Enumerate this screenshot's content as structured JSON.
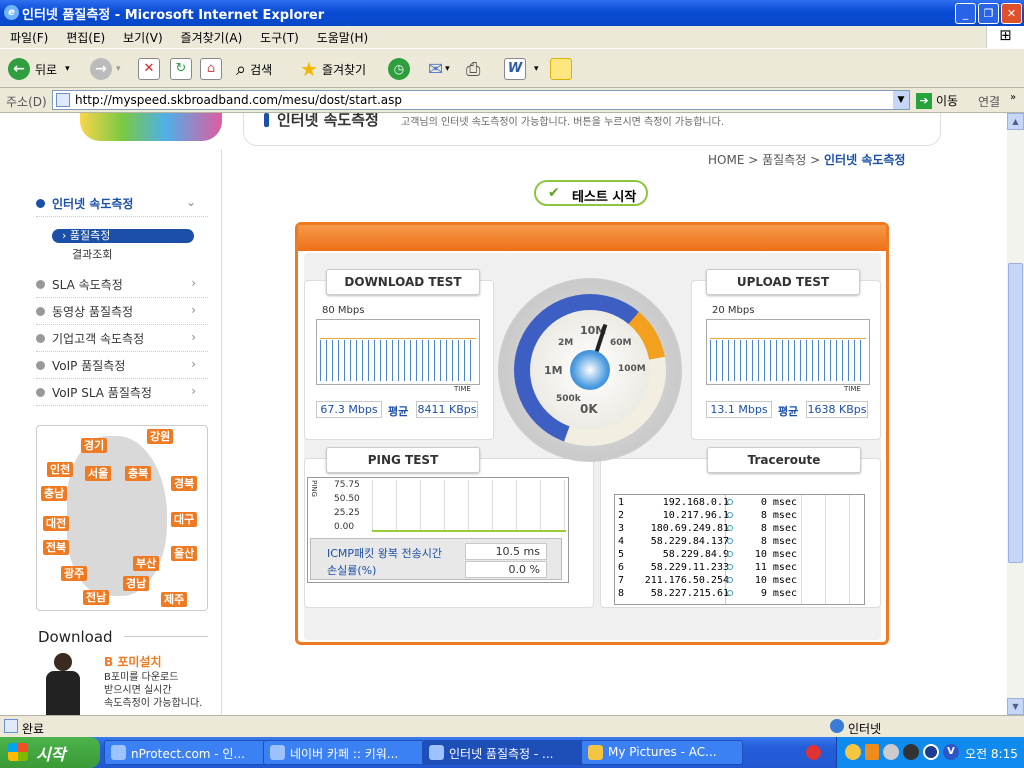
{
  "window": {
    "title": "인터넷 품질측정 - Microsoft Internet Explorer"
  },
  "menu": [
    "파일(F)",
    "편집(E)",
    "보기(V)",
    "즐겨찾기(A)",
    "도구(T)",
    "도움말(H)"
  ],
  "toolbar": {
    "back": "뒤로",
    "search": "검색",
    "favorites": "즐겨찾기"
  },
  "address": {
    "label": "주소(D)",
    "url": "http://myspeed.skbroadband.com/mesu/dost/start.asp",
    "go": "이동",
    "links": "연결"
  },
  "page": {
    "section_title": "인터넷 속도측정",
    "section_desc": "고객님의 인터넷 속도측정이 가능합니다. 버튼을 누르시면 측정이 가능합니다.",
    "breadcrumb": {
      "home": "HOME",
      "sep1": ">",
      "level1": "품질측정",
      "sep2": ">",
      "current": "인터넷 속도측정"
    },
    "start_button": "테스트 시작"
  },
  "sidebar": {
    "items": [
      {
        "label": "인터넷 속도측정",
        "chev": "⌄"
      },
      {
        "label": "SLA 속도측정",
        "chev": "›"
      },
      {
        "label": "동영상 품질측정",
        "chev": "›"
      },
      {
        "label": "기업고객 속도측정",
        "chev": "›"
      },
      {
        "label": "VoIP 품질측정",
        "chev": "›"
      },
      {
        "label": "VoIP SLA 품질측정",
        "chev": "›"
      }
    ],
    "subitems": [
      "품질측정",
      "결과조회"
    ],
    "regions": [
      "경기",
      "강원",
      "인천",
      "서울",
      "충북",
      "경북",
      "충남",
      "대전",
      "대구",
      "전북",
      "부산",
      "울산",
      "광주",
      "경남",
      "전남",
      "제주"
    ],
    "download_title": "Download",
    "promo_title": "B 포미설치",
    "promo_text": [
      "B포미를 다운로드",
      "받으시면 실시간",
      "속도측정이 가능합니다."
    ]
  },
  "test": {
    "download": {
      "label": "DOWNLOAD TEST",
      "scale": "80 Mbps",
      "axis": "TIME",
      "mbps": "67.3 Mbps",
      "avg": "평균",
      "kbps": "8411 KBps"
    },
    "upload": {
      "label": "UPLOAD TEST",
      "scale": "20 Mbps",
      "axis": "TIME",
      "mbps": "13.1 Mbps",
      "avg": "평균",
      "kbps": "1638 KBps"
    },
    "gauge": {
      "labels": [
        "2M",
        "10M",
        "60M",
        "1M",
        "100M",
        "500k",
        "0K"
      ]
    },
    "ping": {
      "label": "PING TEST",
      "axis": "PING",
      "ticks": [
        "75.75",
        "50.50",
        "25.25",
        "0.00"
      ],
      "icmp_label": "ICMP패킷 왕복 전송시간",
      "icmp_value": "10.5 ms",
      "loss_label": "손실률(%)",
      "loss_value": "0.0 %"
    },
    "traceroute": {
      "label": "Traceroute",
      "rows": [
        {
          "n": "1",
          "ip": "192.168.0.1",
          "ms": "0",
          "unit": "msec"
        },
        {
          "n": "2",
          "ip": "10.217.96.1",
          "ms": "8",
          "unit": "msec"
        },
        {
          "n": "3",
          "ip": "180.69.249.81",
          "ms": "8",
          "unit": "msec"
        },
        {
          "n": "4",
          "ip": "58.229.84.137",
          "ms": "8",
          "unit": "msec"
        },
        {
          "n": "5",
          "ip": "58.229.84.9",
          "ms": "10",
          "unit": "msec"
        },
        {
          "n": "6",
          "ip": "58.229.11.233",
          "ms": "11",
          "unit": "msec"
        },
        {
          "n": "7",
          "ip": "211.176.50.254",
          "ms": "10",
          "unit": "msec"
        },
        {
          "n": "8",
          "ip": "58.227.215.61",
          "ms": "9",
          "unit": "msec"
        }
      ]
    }
  },
  "status": {
    "left": "완료",
    "right": "인터넷"
  },
  "taskbar": {
    "start": "시작",
    "tasks": [
      "nProtect.com - 인...",
      "네이버 카페 :: 키워...",
      "인터넷 품질측정 - ...",
      "My Pictures - AC..."
    ],
    "clock": "오전 8:15"
  },
  "colors": {
    "accent": "#f07a22",
    "navy": "#1b4fa8",
    "titlebar": "#0a4bd4"
  }
}
